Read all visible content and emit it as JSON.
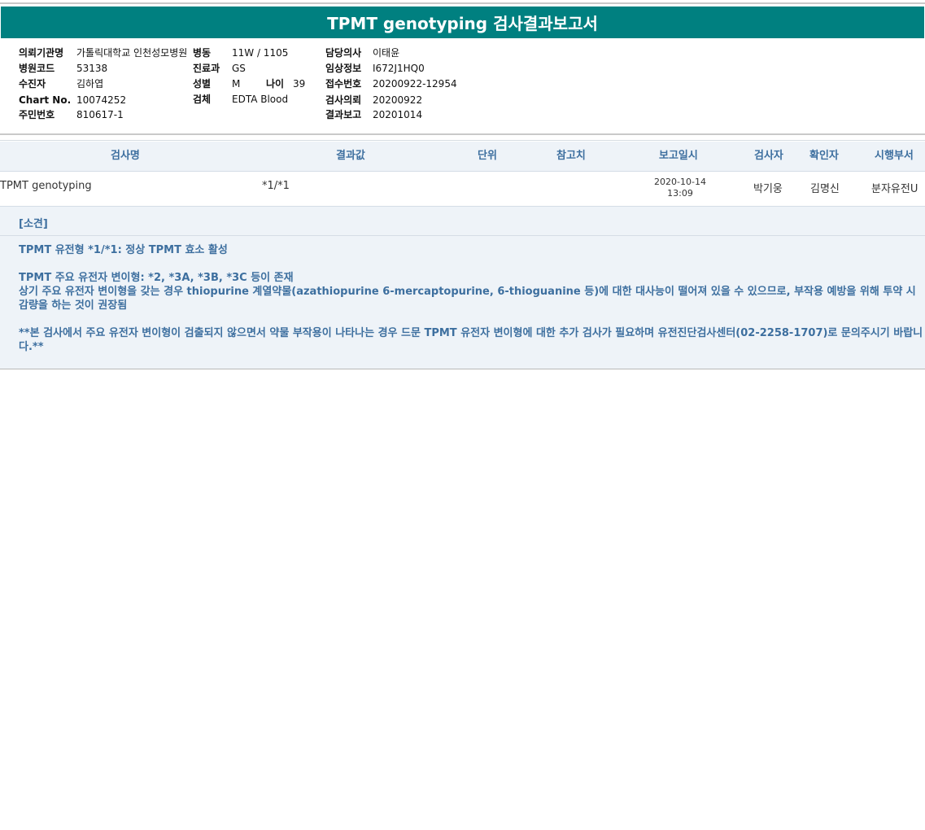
{
  "report": {
    "title": "TPMT genotyping 검사결과보고서"
  },
  "patient_info": {
    "institution": {
      "label": "의뢰기관명",
      "value": "가톨릭대학교 인천성모병원"
    },
    "hospital_code": {
      "label": "병원코드",
      "value": "53138"
    },
    "patient_name": {
      "label": "수진자",
      "value": "김하엽"
    },
    "chart_no": {
      "label": "Chart No.",
      "value": "10074252"
    },
    "resident_no": {
      "label": "주민번호",
      "value": "810617-1"
    },
    "ward": {
      "label": "병동",
      "value": "11W / 1105"
    },
    "department": {
      "label": "진료과",
      "value": "GS"
    },
    "sex": {
      "label": "성별",
      "value": "M"
    },
    "age": {
      "label": "나이",
      "value": "39"
    },
    "specimen": {
      "label": "검체",
      "value": "EDTA Blood"
    },
    "doctor": {
      "label": "담당의사",
      "value": "이태윤"
    },
    "clinical_info": {
      "label": "임상정보",
      "value": "I672J1HQ0"
    },
    "receipt_no": {
      "label": "접수번호",
      "value": "20200922-12954"
    },
    "request_date": {
      "label": "검사의뢰",
      "value": "20200922"
    },
    "report_date": {
      "label": "결과보고",
      "value": "20201014"
    }
  },
  "table": {
    "headers": {
      "test_name": "검사명",
      "result": "결과값",
      "unit": "단위",
      "reference": "참고치",
      "report_datetime": "보고일시",
      "tester": "검사자",
      "verifier": "확인자",
      "department": "시행부서"
    },
    "rows": [
      {
        "test_name": "TPMT genotyping",
        "result": "*1/*1",
        "unit": "",
        "reference": "",
        "report_date": "2020-10-14",
        "report_time": "13:09",
        "tester": "박기웅",
        "verifier": "김명신",
        "department": "분자유전U"
      }
    ]
  },
  "remarks": {
    "title": "[소견]",
    "line1": "TPMT 유전형 *1/*1: 정상 TPMT 효소 활성",
    "line2": "TPMT 주요 유전자 변이형: *2, *3A, *3B, *3C 등이 존재",
    "line3": "상기 주요 유전자 변이형을 갖는 경우 thiopurine 계열약물(azathiopurine 6-mercaptopurine, 6-thioguanine 등)에 대한 대사능이 떨어져 있을 수 있으므로, 부작용 예방을 위해 투약 시 감량을 하는 것이 권장됨",
    "line4": "**본 검사에서 주요 유전자 변이형이 검출되지 않으면서 약물 부작용이 나타나는 경우 드문 TPMT 유전자 변이형에 대한 추가 검사가 필요하며 유전진단검사센터(02-2258-1707)로 문의주시기 바랍니다.**"
  }
}
